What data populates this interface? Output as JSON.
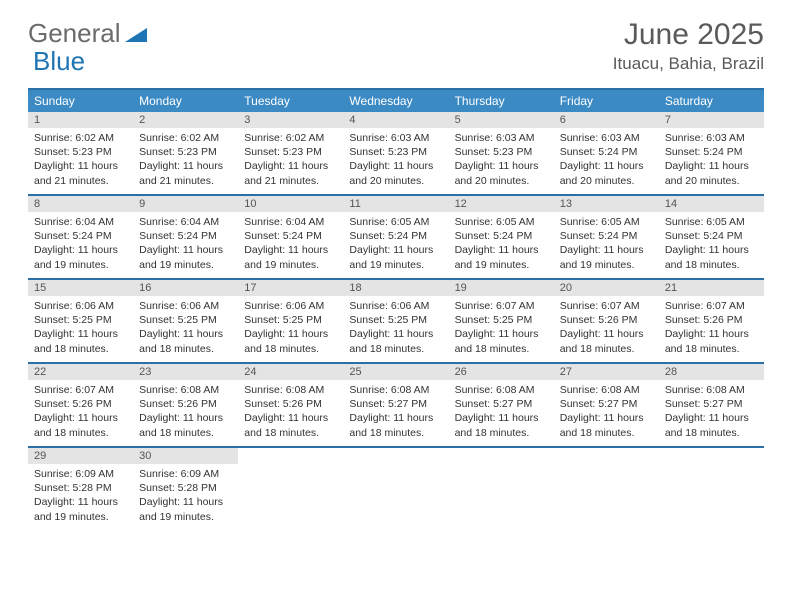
{
  "logo": {
    "part1": "General",
    "part2": "Blue"
  },
  "title": "June 2025",
  "location": "Ituacu, Bahia, Brazil",
  "weekdays": [
    "Sunday",
    "Monday",
    "Tuesday",
    "Wednesday",
    "Thursday",
    "Friday",
    "Saturday"
  ],
  "days": [
    {
      "n": "1",
      "sunrise": "Sunrise: 6:02 AM",
      "sunset": "Sunset: 5:23 PM",
      "daylight": "Daylight: 11 hours and 21 minutes."
    },
    {
      "n": "2",
      "sunrise": "Sunrise: 6:02 AM",
      "sunset": "Sunset: 5:23 PM",
      "daylight": "Daylight: 11 hours and 21 minutes."
    },
    {
      "n": "3",
      "sunrise": "Sunrise: 6:02 AM",
      "sunset": "Sunset: 5:23 PM",
      "daylight": "Daylight: 11 hours and 21 minutes."
    },
    {
      "n": "4",
      "sunrise": "Sunrise: 6:03 AM",
      "sunset": "Sunset: 5:23 PM",
      "daylight": "Daylight: 11 hours and 20 minutes."
    },
    {
      "n": "5",
      "sunrise": "Sunrise: 6:03 AM",
      "sunset": "Sunset: 5:23 PM",
      "daylight": "Daylight: 11 hours and 20 minutes."
    },
    {
      "n": "6",
      "sunrise": "Sunrise: 6:03 AM",
      "sunset": "Sunset: 5:24 PM",
      "daylight": "Daylight: 11 hours and 20 minutes."
    },
    {
      "n": "7",
      "sunrise": "Sunrise: 6:03 AM",
      "sunset": "Sunset: 5:24 PM",
      "daylight": "Daylight: 11 hours and 20 minutes."
    },
    {
      "n": "8",
      "sunrise": "Sunrise: 6:04 AM",
      "sunset": "Sunset: 5:24 PM",
      "daylight": "Daylight: 11 hours and 19 minutes."
    },
    {
      "n": "9",
      "sunrise": "Sunrise: 6:04 AM",
      "sunset": "Sunset: 5:24 PM",
      "daylight": "Daylight: 11 hours and 19 minutes."
    },
    {
      "n": "10",
      "sunrise": "Sunrise: 6:04 AM",
      "sunset": "Sunset: 5:24 PM",
      "daylight": "Daylight: 11 hours and 19 minutes."
    },
    {
      "n": "11",
      "sunrise": "Sunrise: 6:05 AM",
      "sunset": "Sunset: 5:24 PM",
      "daylight": "Daylight: 11 hours and 19 minutes."
    },
    {
      "n": "12",
      "sunrise": "Sunrise: 6:05 AM",
      "sunset": "Sunset: 5:24 PM",
      "daylight": "Daylight: 11 hours and 19 minutes."
    },
    {
      "n": "13",
      "sunrise": "Sunrise: 6:05 AM",
      "sunset": "Sunset: 5:24 PM",
      "daylight": "Daylight: 11 hours and 19 minutes."
    },
    {
      "n": "14",
      "sunrise": "Sunrise: 6:05 AM",
      "sunset": "Sunset: 5:24 PM",
      "daylight": "Daylight: 11 hours and 18 minutes."
    },
    {
      "n": "15",
      "sunrise": "Sunrise: 6:06 AM",
      "sunset": "Sunset: 5:25 PM",
      "daylight": "Daylight: 11 hours and 18 minutes."
    },
    {
      "n": "16",
      "sunrise": "Sunrise: 6:06 AM",
      "sunset": "Sunset: 5:25 PM",
      "daylight": "Daylight: 11 hours and 18 minutes."
    },
    {
      "n": "17",
      "sunrise": "Sunrise: 6:06 AM",
      "sunset": "Sunset: 5:25 PM",
      "daylight": "Daylight: 11 hours and 18 minutes."
    },
    {
      "n": "18",
      "sunrise": "Sunrise: 6:06 AM",
      "sunset": "Sunset: 5:25 PM",
      "daylight": "Daylight: 11 hours and 18 minutes."
    },
    {
      "n": "19",
      "sunrise": "Sunrise: 6:07 AM",
      "sunset": "Sunset: 5:25 PM",
      "daylight": "Daylight: 11 hours and 18 minutes."
    },
    {
      "n": "20",
      "sunrise": "Sunrise: 6:07 AM",
      "sunset": "Sunset: 5:26 PM",
      "daylight": "Daylight: 11 hours and 18 minutes."
    },
    {
      "n": "21",
      "sunrise": "Sunrise: 6:07 AM",
      "sunset": "Sunset: 5:26 PM",
      "daylight": "Daylight: 11 hours and 18 minutes."
    },
    {
      "n": "22",
      "sunrise": "Sunrise: 6:07 AM",
      "sunset": "Sunset: 5:26 PM",
      "daylight": "Daylight: 11 hours and 18 minutes."
    },
    {
      "n": "23",
      "sunrise": "Sunrise: 6:08 AM",
      "sunset": "Sunset: 5:26 PM",
      "daylight": "Daylight: 11 hours and 18 minutes."
    },
    {
      "n": "24",
      "sunrise": "Sunrise: 6:08 AM",
      "sunset": "Sunset: 5:26 PM",
      "daylight": "Daylight: 11 hours and 18 minutes."
    },
    {
      "n": "25",
      "sunrise": "Sunrise: 6:08 AM",
      "sunset": "Sunset: 5:27 PM",
      "daylight": "Daylight: 11 hours and 18 minutes."
    },
    {
      "n": "26",
      "sunrise": "Sunrise: 6:08 AM",
      "sunset": "Sunset: 5:27 PM",
      "daylight": "Daylight: 11 hours and 18 minutes."
    },
    {
      "n": "27",
      "sunrise": "Sunrise: 6:08 AM",
      "sunset": "Sunset: 5:27 PM",
      "daylight": "Daylight: 11 hours and 18 minutes."
    },
    {
      "n": "28",
      "sunrise": "Sunrise: 6:08 AM",
      "sunset": "Sunset: 5:27 PM",
      "daylight": "Daylight: 11 hours and 18 minutes."
    },
    {
      "n": "29",
      "sunrise": "Sunrise: 6:09 AM",
      "sunset": "Sunset: 5:28 PM",
      "daylight": "Daylight: 11 hours and 19 minutes."
    },
    {
      "n": "30",
      "sunrise": "Sunrise: 6:09 AM",
      "sunset": "Sunset: 5:28 PM",
      "daylight": "Daylight: 11 hours and 19 minutes."
    }
  ]
}
